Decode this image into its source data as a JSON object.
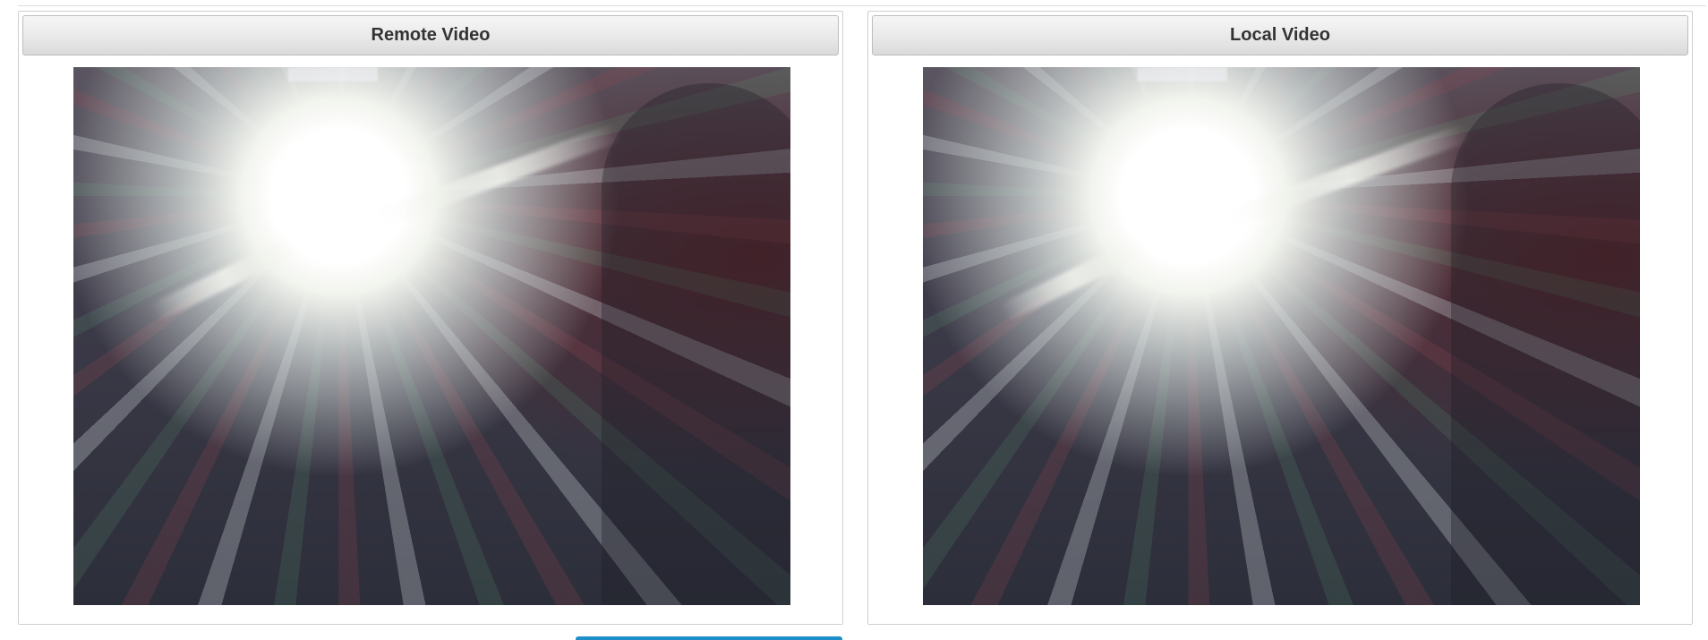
{
  "panels": {
    "remote": {
      "title": "Remote Video"
    },
    "local": {
      "title": "Local Video"
    }
  },
  "colors": {
    "header_text": "#333333",
    "header_gradient_top": "#f6f6f6",
    "header_gradient_bottom": "#dadada",
    "panel_border": "#cfcfcf",
    "accent_tab": "#1e8ec8"
  }
}
